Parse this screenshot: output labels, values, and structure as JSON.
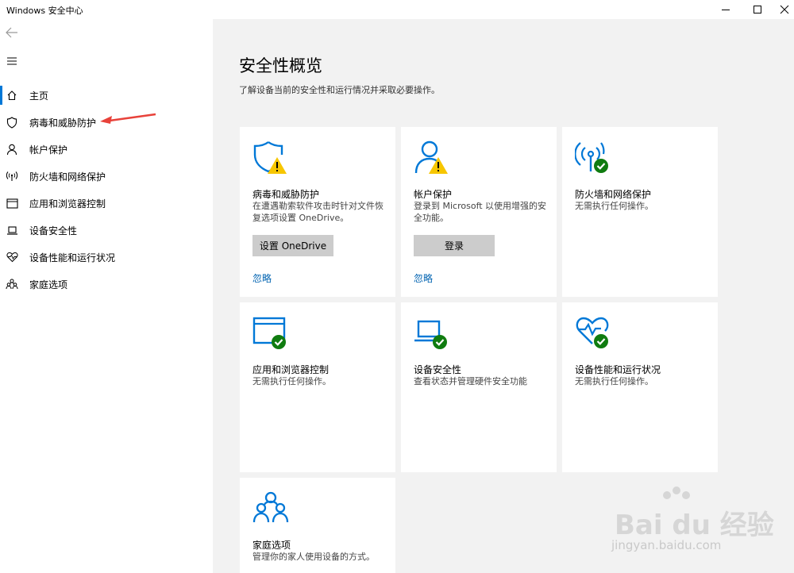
{
  "window": {
    "title": "Windows 安全中心",
    "controls": [
      "minimize-icon",
      "maximize-icon",
      "close-icon"
    ]
  },
  "sidebar": {
    "back_icon": "back-arrow-icon",
    "menu_icon": "hamburger-menu-icon",
    "items": [
      {
        "label": "主页",
        "icon": "home-icon",
        "selected": true
      },
      {
        "label": "病毒和威胁防护",
        "icon": "shield-icon"
      },
      {
        "label": "帐户保护",
        "icon": "person-icon"
      },
      {
        "label": "防火墙和网络保护",
        "icon": "antenna-icon"
      },
      {
        "label": "应用和浏览器控制",
        "icon": "browser-window-icon"
      },
      {
        "label": "设备安全性",
        "icon": "laptop-icon"
      },
      {
        "label": "设备性能和运行状况",
        "icon": "heart-pulse-icon"
      },
      {
        "label": "家庭选项",
        "icon": "family-icon"
      }
    ]
  },
  "main": {
    "title": "安全性概览",
    "subtitle": "了解设备当前的安全性和运行情况并采取必要操作。",
    "cards": [
      {
        "title": "病毒和威胁防护",
        "description": "在遭遇勒索软件攻击时针对文件恢复选项设置 OneDrive。",
        "button": "设置 OneDrive",
        "link": "忽略",
        "icon": "shield-icon",
        "status": "warning"
      },
      {
        "title": "帐户保护",
        "description": "登录到 Microsoft 以使用增强的安全功能。",
        "button": "登录",
        "link": "忽略",
        "icon": "person-icon",
        "status": "warning"
      },
      {
        "title": "防火墙和网络保护",
        "description": "无需执行任何操作。",
        "icon": "antenna-icon",
        "status": "ok"
      },
      {
        "title": "应用和浏览器控制",
        "description": "无需执行任何操作。",
        "icon": "browser-window-icon",
        "status": "ok"
      },
      {
        "title": "设备安全性",
        "description": "查看状态并管理硬件安全功能",
        "icon": "laptop-icon",
        "status": "ok"
      },
      {
        "title": "设备性能和运行状况",
        "description": "无需执行任何操作。",
        "icon": "heart-pulse-icon",
        "status": "ok"
      },
      {
        "title": "家庭选项",
        "description": "管理你的家人使用设备的方式。",
        "icon": "family-icon"
      }
    ]
  },
  "watermark": {
    "brand": "Bai du 经验",
    "url": "jingyan.baidu.com"
  },
  "colors": {
    "accent": "#0078d7",
    "warning": "#f7c600",
    "ok": "#107c10",
    "button": "#cccccc",
    "link": "#0063b1",
    "annotation": "#e8423a"
  }
}
